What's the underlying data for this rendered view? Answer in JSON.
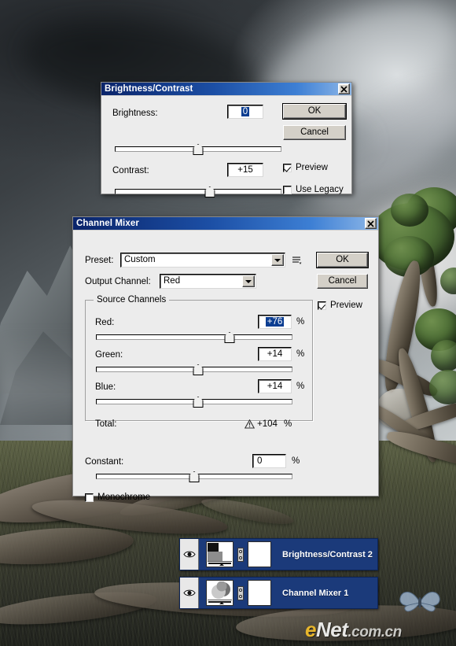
{
  "watermark": {
    "e": "e",
    "net": "Net",
    "domain": ".com.cn"
  },
  "brightness_contrast_dialog": {
    "title": "Brightness/Contrast",
    "close_label": "×",
    "brightness_label": "Brightness:",
    "brightness_value": "0",
    "contrast_label": "Contrast:",
    "contrast_value": "+15",
    "ok_label": "OK",
    "cancel_label": "Cancel",
    "preview_label": "Preview",
    "preview_checked": true,
    "use_legacy_label": "Use Legacy",
    "use_legacy_checked": false
  },
  "channel_mixer_dialog": {
    "title": "Channel Mixer",
    "close_label": "×",
    "preset_label": "Preset:",
    "preset_value": "Custom",
    "output_channel_label": "Output Channel:",
    "output_channel_value": "Red",
    "source_channels_label": "Source Channels",
    "red_label": "Red:",
    "red_value": "+76",
    "green_label": "Green:",
    "green_value": "+14",
    "blue_label": "Blue:",
    "blue_value": "+14",
    "total_label": "Total:",
    "total_value": "+104",
    "constant_label": "Constant:",
    "constant_value": "0",
    "percent_symbol": "%",
    "monochrome_label": "Monochrome",
    "monochrome_checked": false,
    "ok_label": "OK",
    "cancel_label": "Cancel",
    "preview_label": "Preview",
    "preview_checked": true
  },
  "layers_panel": {
    "layers": [
      {
        "name": "Brightness/Contrast 2",
        "visible": true,
        "thumb": "brightness-contrast-thumbnail"
      },
      {
        "name": "Channel Mixer 1",
        "visible": true,
        "thumb": "channel-mixer-thumbnail"
      }
    ]
  },
  "colors": {
    "titlebar_start": "#0a246a",
    "titlebar_end": "#8fb8e8",
    "dialog_face": "#ececec",
    "button_face": "#d4d0c8",
    "layer_selected": "#1b3a7a",
    "selection_highlight": "#0b3d91",
    "watermark_accent": "#e8b62c"
  }
}
